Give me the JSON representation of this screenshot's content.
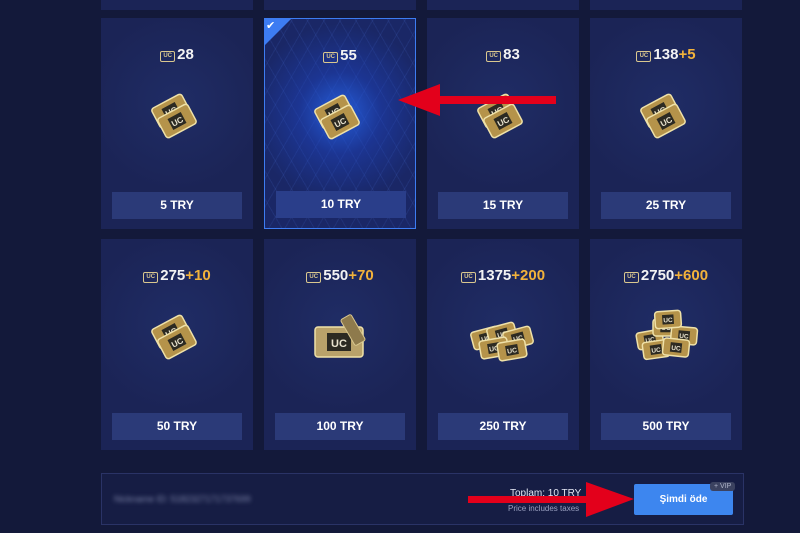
{
  "products": [
    {
      "amount": "28",
      "bonus": "",
      "price": "5 TRY",
      "pack": "small"
    },
    {
      "amount": "55",
      "bonus": "",
      "price": "10 TRY",
      "pack": "small"
    },
    {
      "amount": "83",
      "bonus": "",
      "price": "15 TRY",
      "pack": "small"
    },
    {
      "amount": "138",
      "bonus": "+5",
      "price": "25 TRY",
      "pack": "small"
    },
    {
      "amount": "275",
      "bonus": "+10",
      "price": "50 TRY",
      "pack": "small"
    },
    {
      "amount": "550",
      "bonus": "+70",
      "price": "100 TRY",
      "pack": "box"
    },
    {
      "amount": "1375",
      "bonus": "+200",
      "price": "250 TRY",
      "pack": "stack"
    },
    {
      "amount": "2750",
      "bonus": "+600",
      "price": "500 TRY",
      "pack": "pile"
    }
  ],
  "selected_index": 1,
  "currency_icon": {
    "name": "uc-icon",
    "text": "UC"
  },
  "check_icon": "✔",
  "footer": {
    "blurred_text": "Nickname ID: 5182327171737699",
    "total": "Toplam: 10 TRY",
    "tax_note": "Price includes taxes",
    "pay_label": "Şimdi öde",
    "vip_label": "+ VIP"
  },
  "colors": {
    "accent": "#3d86ef",
    "bonus": "#f2b23b",
    "annotation": "#e3001b"
  }
}
